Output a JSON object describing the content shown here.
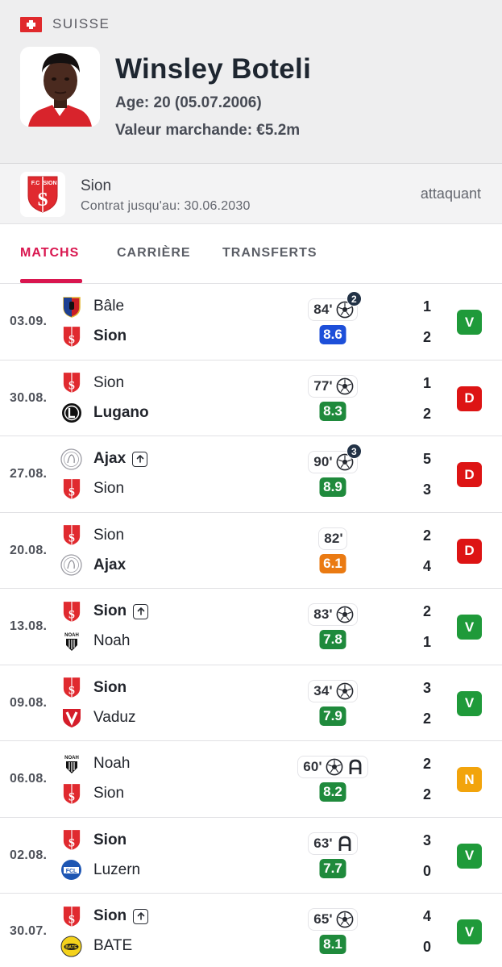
{
  "player": {
    "country": "SUISSE",
    "name": "Winsley Boteli",
    "age_line": "Age: 20 (05.07.2006)",
    "value_line": "Valeur marchande: €5.2m"
  },
  "club": {
    "name": "Sion",
    "contract": "Contrat jusqu'au: 30.06.2030",
    "position": "attaquant"
  },
  "tabs": [
    {
      "label": "MATCHS",
      "active": true
    },
    {
      "label": "CARRIÈRE",
      "active": false
    },
    {
      "label": "TRANSFERTS",
      "active": false
    }
  ],
  "colors": {
    "accent": "#d9164f",
    "win": "#1f9a3a",
    "loss": "#dd1414",
    "draw": "#f2a40c",
    "rating_blue": "#1d4fd9",
    "rating_green": "#1f8a3c",
    "rating_orange": "#ea7a12"
  },
  "matches": [
    {
      "date": "03.09.",
      "home": {
        "name": "Bâle",
        "logo": "basel-logo",
        "bold": false,
        "arrow": false
      },
      "away": {
        "name": "Sion",
        "logo": "sion-logo",
        "bold": true,
        "arrow": false
      },
      "score_home": "1",
      "score_away": "2",
      "minutes": "84'",
      "goals": 2,
      "goal_badge": "2",
      "assist": false,
      "rating": "8.6",
      "rating_color": "#1d4fd9",
      "result": "V",
      "result_color": "#1f9a3a"
    },
    {
      "date": "30.08.",
      "home": {
        "name": "Sion",
        "logo": "sion-logo",
        "bold": false,
        "arrow": false
      },
      "away": {
        "name": "Lugano",
        "logo": "lugano-logo",
        "bold": true,
        "arrow": false
      },
      "score_home": "1",
      "score_away": "2",
      "minutes": "77'",
      "goals": 1,
      "goal_badge": "",
      "assist": false,
      "rating": "8.3",
      "rating_color": "#1f8a3c",
      "result": "D",
      "result_color": "#dd1414"
    },
    {
      "date": "27.08.",
      "home": {
        "name": "Ajax",
        "logo": "ajax-logo",
        "bold": true,
        "arrow": true
      },
      "away": {
        "name": "Sion",
        "logo": "sion-logo",
        "bold": false,
        "arrow": false
      },
      "score_home": "5",
      "score_away": "3",
      "minutes": "90'",
      "goals": 3,
      "goal_badge": "3",
      "assist": false,
      "rating": "8.9",
      "rating_color": "#1f8a3c",
      "result": "D",
      "result_color": "#dd1414"
    },
    {
      "date": "20.08.",
      "home": {
        "name": "Sion",
        "logo": "sion-logo",
        "bold": false,
        "arrow": false
      },
      "away": {
        "name": "Ajax",
        "logo": "ajax-logo",
        "bold": true,
        "arrow": false
      },
      "score_home": "2",
      "score_away": "4",
      "minutes": "82'",
      "goals": 0,
      "goal_badge": "",
      "assist": false,
      "rating": "6.1",
      "rating_color": "#ea7a12",
      "result": "D",
      "result_color": "#dd1414"
    },
    {
      "date": "13.08.",
      "home": {
        "name": "Sion",
        "logo": "sion-logo",
        "bold": true,
        "arrow": true
      },
      "away": {
        "name": "Noah",
        "logo": "noah-logo",
        "bold": false,
        "arrow": false
      },
      "score_home": "2",
      "score_away": "1",
      "minutes": "83'",
      "goals": 1,
      "goal_badge": "",
      "assist": false,
      "rating": "7.8",
      "rating_color": "#1f8a3c",
      "result": "V",
      "result_color": "#1f9a3a"
    },
    {
      "date": "09.08.",
      "home": {
        "name": "Sion",
        "logo": "sion-logo",
        "bold": true,
        "arrow": false
      },
      "away": {
        "name": "Vaduz",
        "logo": "vaduz-logo",
        "bold": false,
        "arrow": false
      },
      "score_home": "3",
      "score_away": "2",
      "minutes": "34'",
      "goals": 1,
      "goal_badge": "",
      "assist": false,
      "rating": "7.9",
      "rating_color": "#1f8a3c",
      "result": "V",
      "result_color": "#1f9a3a"
    },
    {
      "date": "06.08.",
      "home": {
        "name": "Noah",
        "logo": "noah-logo",
        "bold": false,
        "arrow": false
      },
      "away": {
        "name": "Sion",
        "logo": "sion-logo",
        "bold": false,
        "arrow": false
      },
      "score_home": "2",
      "score_away": "2",
      "minutes": "60'",
      "goals": 1,
      "goal_badge": "",
      "assist": true,
      "rating": "8.2",
      "rating_color": "#1f8a3c",
      "result": "N",
      "result_color": "#f2a40c"
    },
    {
      "date": "02.08.",
      "home": {
        "name": "Sion",
        "logo": "sion-logo",
        "bold": true,
        "arrow": false
      },
      "away": {
        "name": "Luzern",
        "logo": "luzern-logo",
        "bold": false,
        "arrow": false
      },
      "score_home": "3",
      "score_away": "0",
      "minutes": "63'",
      "goals": 0,
      "goal_badge": "",
      "assist": true,
      "rating": "7.7",
      "rating_color": "#1f8a3c",
      "result": "V",
      "result_color": "#1f9a3a"
    },
    {
      "date": "30.07.",
      "home": {
        "name": "Sion",
        "logo": "sion-logo",
        "bold": true,
        "arrow": true
      },
      "away": {
        "name": "BATE",
        "logo": "bate-logo",
        "bold": false,
        "arrow": false
      },
      "score_home": "4",
      "score_away": "0",
      "minutes": "65'",
      "goals": 1,
      "goal_badge": "",
      "assist": false,
      "rating": "8.1",
      "rating_color": "#1f8a3c",
      "result": "V",
      "result_color": "#1f9a3a"
    }
  ]
}
